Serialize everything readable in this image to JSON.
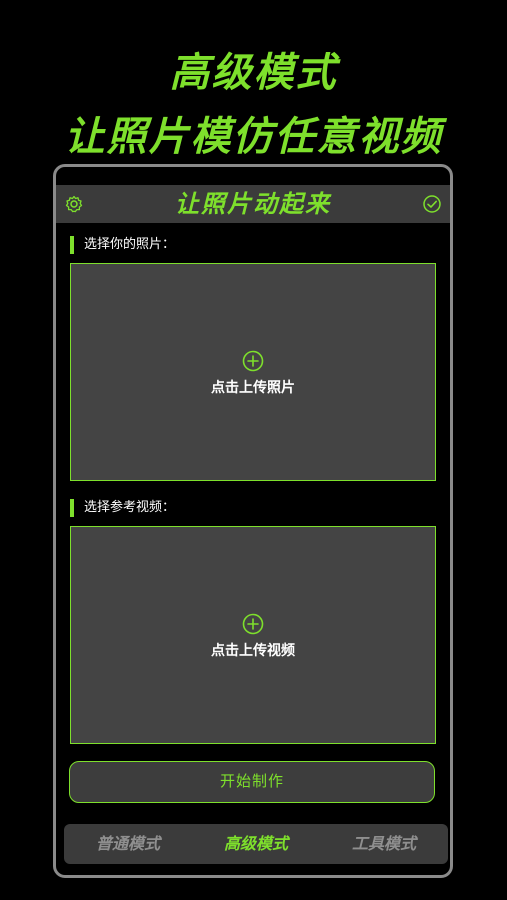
{
  "promo": {
    "title_line1": "高级模式",
    "title_line2": "让照片模仿任意视频"
  },
  "header": {
    "title": "让照片动起来",
    "left_icon": "gear-icon",
    "right_icon": "check-circle-icon"
  },
  "photo_section": {
    "label": "选择你的照片：",
    "upload_label": "点击上传照片",
    "icon": "plus-circle-icon"
  },
  "video_section": {
    "label": "选择参考视频：",
    "upload_label": "点击上传视频",
    "icon": "plus-circle-icon"
  },
  "actions": {
    "start_label": "开始制作"
  },
  "bottom_nav": {
    "items": [
      {
        "label": "普通模式",
        "active": false
      },
      {
        "label": "高级模式",
        "active": true
      },
      {
        "label": "工具模式",
        "active": false
      }
    ]
  },
  "colors": {
    "accent": "#7ee02c",
    "background": "#000000",
    "panel": "#444444",
    "header": "#3b3b3b",
    "inactive_text": "#8f8f8f"
  }
}
